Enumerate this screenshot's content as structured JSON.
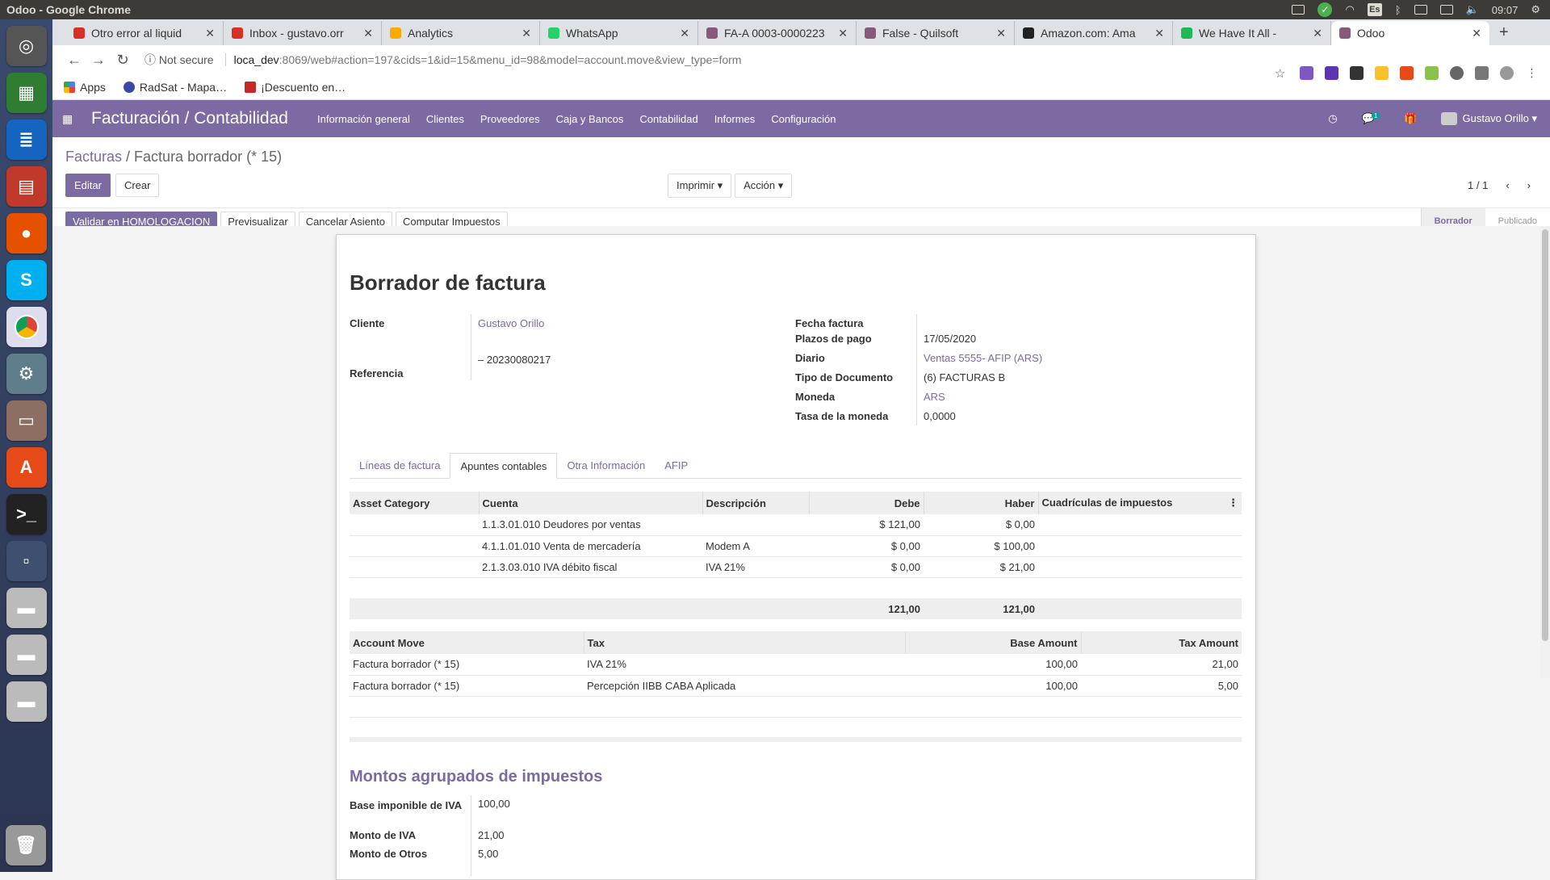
{
  "os": {
    "window_title": "Odoo - Google Chrome",
    "clock": "09:07",
    "lang": "Es"
  },
  "tabs": [
    {
      "title": "Otro error al liquid",
      "color": "#d93025"
    },
    {
      "title": "Inbox - gustavo.orr",
      "color": "#d93025"
    },
    {
      "title": "Analytics",
      "color": "#f9ab00"
    },
    {
      "title": "WhatsApp",
      "color": "#25d366"
    },
    {
      "title": "FA-A 0003-0000223",
      "color": "#875a7b"
    },
    {
      "title": "False - Quilsoft",
      "color": "#875a7b"
    },
    {
      "title": "Amazon.com: Ama",
      "color": "#222222"
    },
    {
      "title": "We Have It All -",
      "color": "#1db954"
    },
    {
      "title": "Odoo",
      "color": "#875a7b"
    }
  ],
  "address": {
    "security": "Not secure",
    "host": "loca_dev",
    "path": ":8069/web#action=197&cids=1&id=15&menu_id=98&model=account.move&view_type=form"
  },
  "bookmarks": [
    "Apps",
    "RadSat - Mapa…",
    "¡Descuento en…"
  ],
  "app": {
    "brand": "Facturación / Contabilidad",
    "menus": [
      "Información general",
      "Clientes",
      "Proveedores",
      "Caja y Bancos",
      "Contabilidad",
      "Informes",
      "Configuración"
    ],
    "chat_badge": "1",
    "user": "Gustavo Orillo"
  },
  "breadcrumb": {
    "parent": "Facturas",
    "current": "Factura borrador (* 15)"
  },
  "buttons": {
    "edit": "Editar",
    "create": "Crear",
    "print": "Imprimir",
    "action": "Acción"
  },
  "pager": "1 / 1",
  "status_buttons": [
    "Validar en HOMOLOGACION",
    "Previsualizar",
    "Cancelar Asiento",
    "Computar Impuestos"
  ],
  "stages": [
    "Borrador",
    "Publicado"
  ],
  "form": {
    "title": "Borrador de factura",
    "cliente_label": "Cliente",
    "cliente": "Gustavo Orillo",
    "cuit": "– 20230080217",
    "referencia_label": "Referencia",
    "fecha_label": "Fecha factura",
    "plazos_label": "Plazos de pago",
    "plazos": "17/05/2020",
    "diario_label": "Diario",
    "diario": "Ventas 5555- AFIP (ARS)",
    "tipo_label": "Tipo de Documento",
    "tipo": "(6) FACTURAS B",
    "moneda_label": "Moneda",
    "moneda": "ARS",
    "tasa_label": "Tasa de la moneda",
    "tasa": "0,0000"
  },
  "notebook": [
    "Líneas de factura",
    "Apuntes contables",
    "Otra Información",
    "AFIP"
  ],
  "journal_table": {
    "headers": [
      "Asset Category",
      "Cuenta",
      "Descripción",
      "Debe",
      "Haber",
      "Cuadrículas de impuestos"
    ],
    "rows": [
      [
        "",
        "1.1.3.01.010 Deudores por ventas",
        "",
        "$ 121,00",
        "$ 0,00",
        ""
      ],
      [
        "",
        "4.1.1.01.010 Venta de mercadería",
        "Modem A",
        "$ 0,00",
        "$ 100,00",
        ""
      ],
      [
        "",
        "2.1.3.03.010 IVA débito fiscal",
        "IVA 21%",
        "$ 0,00",
        "$ 21,00",
        ""
      ]
    ],
    "total_debe": "121,00",
    "total_haber": "121,00"
  },
  "tax_table": {
    "headers": [
      "Account Move",
      "Tax",
      "Base Amount",
      "Tax Amount"
    ],
    "rows": [
      [
        "Factura borrador (* 15)",
        "IVA 21%",
        "100,00",
        "21,00"
      ],
      [
        "Factura borrador (* 15)",
        "Percepción IIBB CABA Aplicada",
        "100,00",
        "5,00"
      ]
    ]
  },
  "grouped": {
    "title": "Montos agrupados de impuestos",
    "base_label": "Base imponible de IVA",
    "base": "100,00",
    "iva_label": "Monto de IVA",
    "iva": "21,00",
    "otros_label": "Monto de Otros",
    "otros": "5,00"
  }
}
